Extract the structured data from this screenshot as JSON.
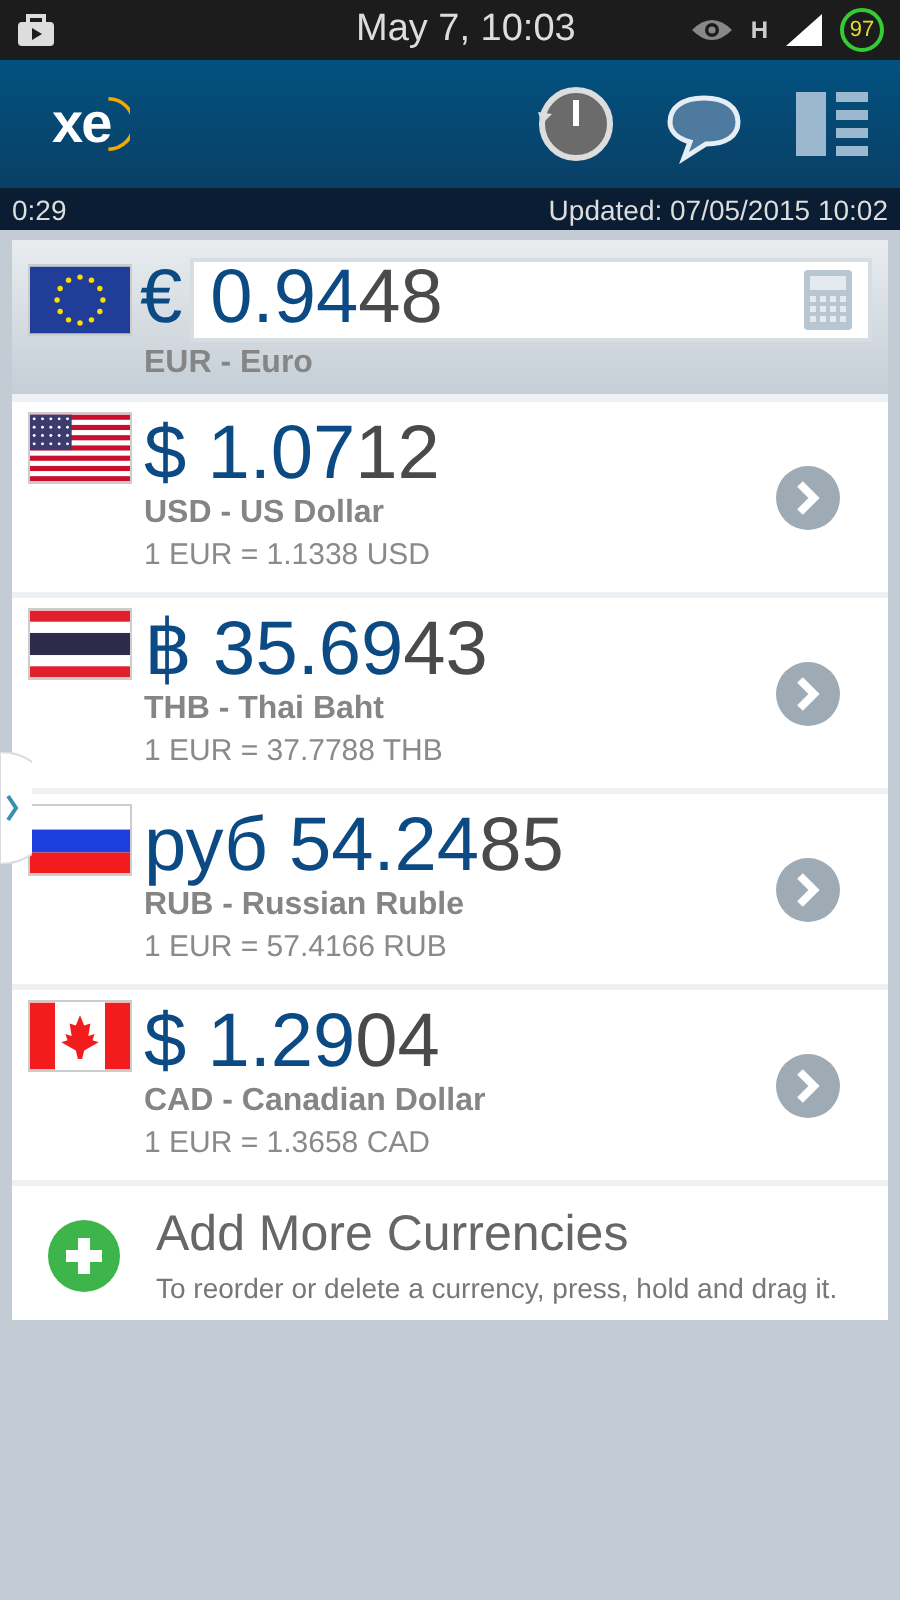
{
  "status_bar": {
    "time": "May 7, 10:03",
    "network": "H",
    "battery": "97"
  },
  "header": {
    "logo": "xe"
  },
  "update_bar": {
    "left": "0:29",
    "updated": "Updated:  07/05/2015 10:02"
  },
  "base_currency": {
    "kind": "eu",
    "symbol": "€",
    "amount_main": "0.94",
    "amount_tail": "48",
    "name": "EUR - Euro"
  },
  "currencies": [
    {
      "kind": "us",
      "symbol": "$",
      "amount_main": "1.07",
      "amount_tail": "12",
      "name": "USD - US Dollar",
      "rate": "1 EUR = 1.1338 USD"
    },
    {
      "kind": "th",
      "symbol": "฿",
      "amount_main": "35.69",
      "amount_tail": "43",
      "name": "THB - Thai Baht",
      "rate": "1 EUR = 37.7788 THB"
    },
    {
      "kind": "ru",
      "symbol": "руб",
      "amount_main": "54.24",
      "amount_tail": "85",
      "name": "RUB - Russian Ruble",
      "rate": "1 EUR = 57.4166 RUB"
    },
    {
      "kind": "ca",
      "symbol": "$",
      "amount_main": "1.29",
      "amount_tail": "04",
      "name": "CAD - Canadian Dollar",
      "rate": "1 EUR = 1.3658 CAD"
    }
  ],
  "add_more": {
    "title": "Add More Currencies",
    "hint": "To reorder or delete a currency, press, hold and drag it."
  }
}
